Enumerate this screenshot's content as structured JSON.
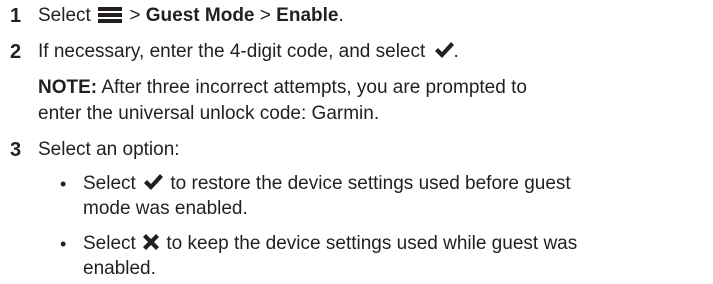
{
  "steps": [
    {
      "number": "1",
      "parts": {
        "select": "Select",
        "menu_icon": "menu-icon",
        "sep1": ">",
        "guest_mode": "Guest Mode",
        "sep2": ">",
        "enable": "Enable",
        "end": "."
      }
    },
    {
      "number": "2",
      "text_a": "If necessary, enter the 4-digit code, and select",
      "check_icon": "check-icon",
      "text_b": ".",
      "note_label": "NOTE:",
      "note_line1": "After three incorrect attempts, you are prompted to",
      "note_line2": "enter the universal unlock code: Garmin."
    },
    {
      "number": "3",
      "text": "Select an option:",
      "options": [
        {
          "bullet": "•",
          "select": "Select",
          "icon": "check-icon",
          "line1": "to restore the device settings used before guest",
          "line2": "mode was enabled."
        },
        {
          "bullet": "•",
          "select": "Select",
          "icon": "x-icon",
          "line1": "to keep the device settings used while guest was",
          "line2": "enabled."
        }
      ]
    }
  ],
  "colors": {
    "text": "#231f20",
    "background": "#ffffff"
  }
}
